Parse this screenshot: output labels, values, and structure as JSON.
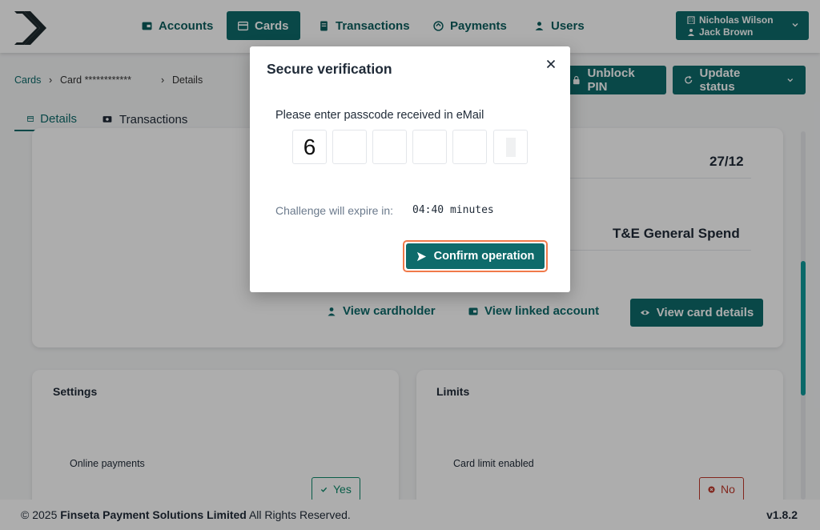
{
  "header": {
    "nav": [
      {
        "label": "Accounts",
        "icon": "wallet-icon",
        "active": false
      },
      {
        "label": "Cards",
        "icon": "card-icon",
        "active": true
      },
      {
        "label": "Transactions",
        "icon": "receipt-icon",
        "active": false
      },
      {
        "label": "Payments",
        "icon": "payments-icon",
        "active": false
      },
      {
        "label": "Users",
        "icon": "users-icon",
        "active": false
      }
    ],
    "user": {
      "organization": "Nicholas Wilson",
      "name": "Jack Brown"
    }
  },
  "breadcrumb": {
    "root": "Cards",
    "card": "Card ************",
    "current": "Details"
  },
  "toolbar": {
    "unblock_pin": "Unblock PIN",
    "update_status": "Update status"
  },
  "tabs": [
    {
      "label": "Details",
      "active": true
    },
    {
      "label": "Transactions",
      "active": false
    }
  ],
  "card_panel": {
    "expiry": "27/12",
    "card_name": "T&E General Spend",
    "view_cardholder": "View cardholder",
    "view_linked_account": "View linked account",
    "view_card_details": "View card details"
  },
  "settings": {
    "title": "Settings",
    "online_payments_label": "Online payments",
    "online_payments_value": "Yes"
  },
  "limits": {
    "title": "Limits",
    "card_limit_label": "Card limit enabled",
    "card_limit_value": "No"
  },
  "footer": {
    "copyright_prefix": "© 2025",
    "company": "Finseta Payment Solutions Limited",
    "copyright_suffix": "All Rights Reserved.",
    "version": "v1.8.2"
  },
  "modal": {
    "title": "Secure verification",
    "prompt": "Please enter passcode received in eMail",
    "code_digits": [
      "6",
      "",
      "",
      "",
      "",
      ""
    ],
    "expire_label": "Challenge will expire in:",
    "expire_value": "04:40 minutes",
    "confirm_label": "Confirm operation"
  },
  "colors": {
    "primary": "#0e6b6b",
    "focus_ring": "#f07a4a",
    "success": "#0e8a6a",
    "danger": "#c0392b"
  }
}
